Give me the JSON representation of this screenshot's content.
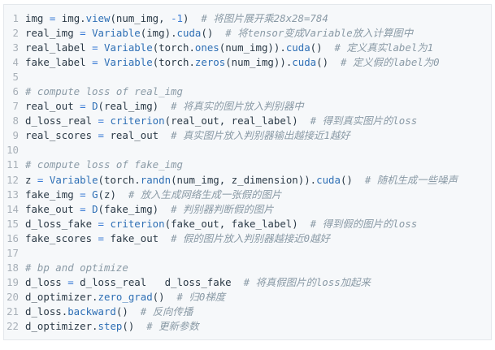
{
  "editor": {
    "title": "",
    "lines": [
      [
        {
          "t": "img ",
          "k": "plain"
        },
        {
          "t": "=",
          "k": "op"
        },
        {
          "t": " img.",
          "k": "plain"
        },
        {
          "t": "view",
          "k": "fn"
        },
        {
          "t": "(num_img, ",
          "k": "plain"
        },
        {
          "t": "-1",
          "k": "op"
        },
        {
          "t": ")  ",
          "k": "plain"
        },
        {
          "t": "# 将图片展开乘28x28=784",
          "k": "cm"
        }
      ],
      [
        {
          "t": "real_img ",
          "k": "plain"
        },
        {
          "t": "=",
          "k": "op"
        },
        {
          "t": " ",
          "k": "plain"
        },
        {
          "t": "Variable",
          "k": "fn"
        },
        {
          "t": "(img).",
          "k": "plain"
        },
        {
          "t": "cuda",
          "k": "fn"
        },
        {
          "t": "()  ",
          "k": "plain"
        },
        {
          "t": "# 将tensor变成Variable放入计算图中",
          "k": "cm"
        }
      ],
      [
        {
          "t": "real_label ",
          "k": "plain"
        },
        {
          "t": "=",
          "k": "op"
        },
        {
          "t": " ",
          "k": "plain"
        },
        {
          "t": "Variable",
          "k": "fn"
        },
        {
          "t": "(torch.",
          "k": "plain"
        },
        {
          "t": "ones",
          "k": "fn"
        },
        {
          "t": "(num_img)).",
          "k": "plain"
        },
        {
          "t": "cuda",
          "k": "fn"
        },
        {
          "t": "()  ",
          "k": "plain"
        },
        {
          "t": "# 定义真实label为1",
          "k": "cm"
        }
      ],
      [
        {
          "t": "fake_label ",
          "k": "plain"
        },
        {
          "t": "=",
          "k": "op"
        },
        {
          "t": " ",
          "k": "plain"
        },
        {
          "t": "Variable",
          "k": "fn"
        },
        {
          "t": "(torch.",
          "k": "plain"
        },
        {
          "t": "zeros",
          "k": "fn"
        },
        {
          "t": "(num_img)).",
          "k": "plain"
        },
        {
          "t": "cuda",
          "k": "fn"
        },
        {
          "t": "()  ",
          "k": "plain"
        },
        {
          "t": "# 定义假的label为0",
          "k": "cm"
        }
      ],
      [],
      [
        {
          "t": "# compute loss of real_img",
          "k": "cm"
        }
      ],
      [
        {
          "t": "real_out ",
          "k": "plain"
        },
        {
          "t": "=",
          "k": "op"
        },
        {
          "t": " ",
          "k": "plain"
        },
        {
          "t": "D",
          "k": "fn"
        },
        {
          "t": "(real_img)  ",
          "k": "plain"
        },
        {
          "t": "# 将真实的图片放入判别器中",
          "k": "cm"
        }
      ],
      [
        {
          "t": "d_loss_real ",
          "k": "plain"
        },
        {
          "t": "=",
          "k": "op"
        },
        {
          "t": " ",
          "k": "plain"
        },
        {
          "t": "criterion",
          "k": "fn"
        },
        {
          "t": "(real_out, real_label)  ",
          "k": "plain"
        },
        {
          "t": "# 得到真实图片的loss",
          "k": "cm"
        }
      ],
      [
        {
          "t": "real_scores ",
          "k": "plain"
        },
        {
          "t": "=",
          "k": "op"
        },
        {
          "t": " real_out  ",
          "k": "plain"
        },
        {
          "t": "# 真实图片放入判别器输出越接近1越好",
          "k": "cm"
        }
      ],
      [],
      [
        {
          "t": "# compute loss of fake_img",
          "k": "cm"
        }
      ],
      [
        {
          "t": "z ",
          "k": "plain"
        },
        {
          "t": "=",
          "k": "op"
        },
        {
          "t": " ",
          "k": "plain"
        },
        {
          "t": "Variable",
          "k": "fn"
        },
        {
          "t": "(torch.",
          "k": "plain"
        },
        {
          "t": "randn",
          "k": "fn"
        },
        {
          "t": "(num_img, z_dimension)).",
          "k": "plain"
        },
        {
          "t": "cuda",
          "k": "fn"
        },
        {
          "t": "()  ",
          "k": "plain"
        },
        {
          "t": "# 随机生成一些噪声",
          "k": "cm"
        }
      ],
      [
        {
          "t": "fake_img ",
          "k": "plain"
        },
        {
          "t": "=",
          "k": "op"
        },
        {
          "t": " ",
          "k": "plain"
        },
        {
          "t": "G",
          "k": "fn"
        },
        {
          "t": "(z)  ",
          "k": "plain"
        },
        {
          "t": "# 放入生成网络生成一张假的图片",
          "k": "cm"
        }
      ],
      [
        {
          "t": "fake_out ",
          "k": "plain"
        },
        {
          "t": "=",
          "k": "op"
        },
        {
          "t": " ",
          "k": "plain"
        },
        {
          "t": "D",
          "k": "fn"
        },
        {
          "t": "(fake_img)  ",
          "k": "plain"
        },
        {
          "t": "# 判别器判断假的图片",
          "k": "cm"
        }
      ],
      [
        {
          "t": "d_loss_fake ",
          "k": "plain"
        },
        {
          "t": "=",
          "k": "op"
        },
        {
          "t": " ",
          "k": "plain"
        },
        {
          "t": "criterion",
          "k": "fn"
        },
        {
          "t": "(fake_out, fake_label)  ",
          "k": "plain"
        },
        {
          "t": "# 得到假的图片的loss",
          "k": "cm"
        }
      ],
      [
        {
          "t": "fake_scores ",
          "k": "plain"
        },
        {
          "t": "=",
          "k": "op"
        },
        {
          "t": " fake_out  ",
          "k": "plain"
        },
        {
          "t": "# 假的图片放入判别器越接近0越好",
          "k": "cm"
        }
      ],
      [],
      [
        {
          "t": "# bp and optimize",
          "k": "cm"
        }
      ],
      [
        {
          "t": "d_loss ",
          "k": "plain"
        },
        {
          "t": "=",
          "k": "op"
        },
        {
          "t": " d_loss_real   d_loss_fake  ",
          "k": "plain"
        },
        {
          "t": "# 将真假图片的loss加起来",
          "k": "cm"
        }
      ],
      [
        {
          "t": "d_optimizer.",
          "k": "plain"
        },
        {
          "t": "zero_grad",
          "k": "fn"
        },
        {
          "t": "()  ",
          "k": "plain"
        },
        {
          "t": "# 归0梯度",
          "k": "cm"
        }
      ],
      [
        {
          "t": "d_loss.",
          "k": "plain"
        },
        {
          "t": "backward",
          "k": "fn"
        },
        {
          "t": "()  ",
          "k": "plain"
        },
        {
          "t": "# 反向传播",
          "k": "cm"
        }
      ],
      [
        {
          "t": "d_optimizer.",
          "k": "plain"
        },
        {
          "t": "step",
          "k": "fn"
        },
        {
          "t": "()  ",
          "k": "plain"
        },
        {
          "t": "# 更新参数",
          "k": "cm"
        }
      ]
    ]
  }
}
